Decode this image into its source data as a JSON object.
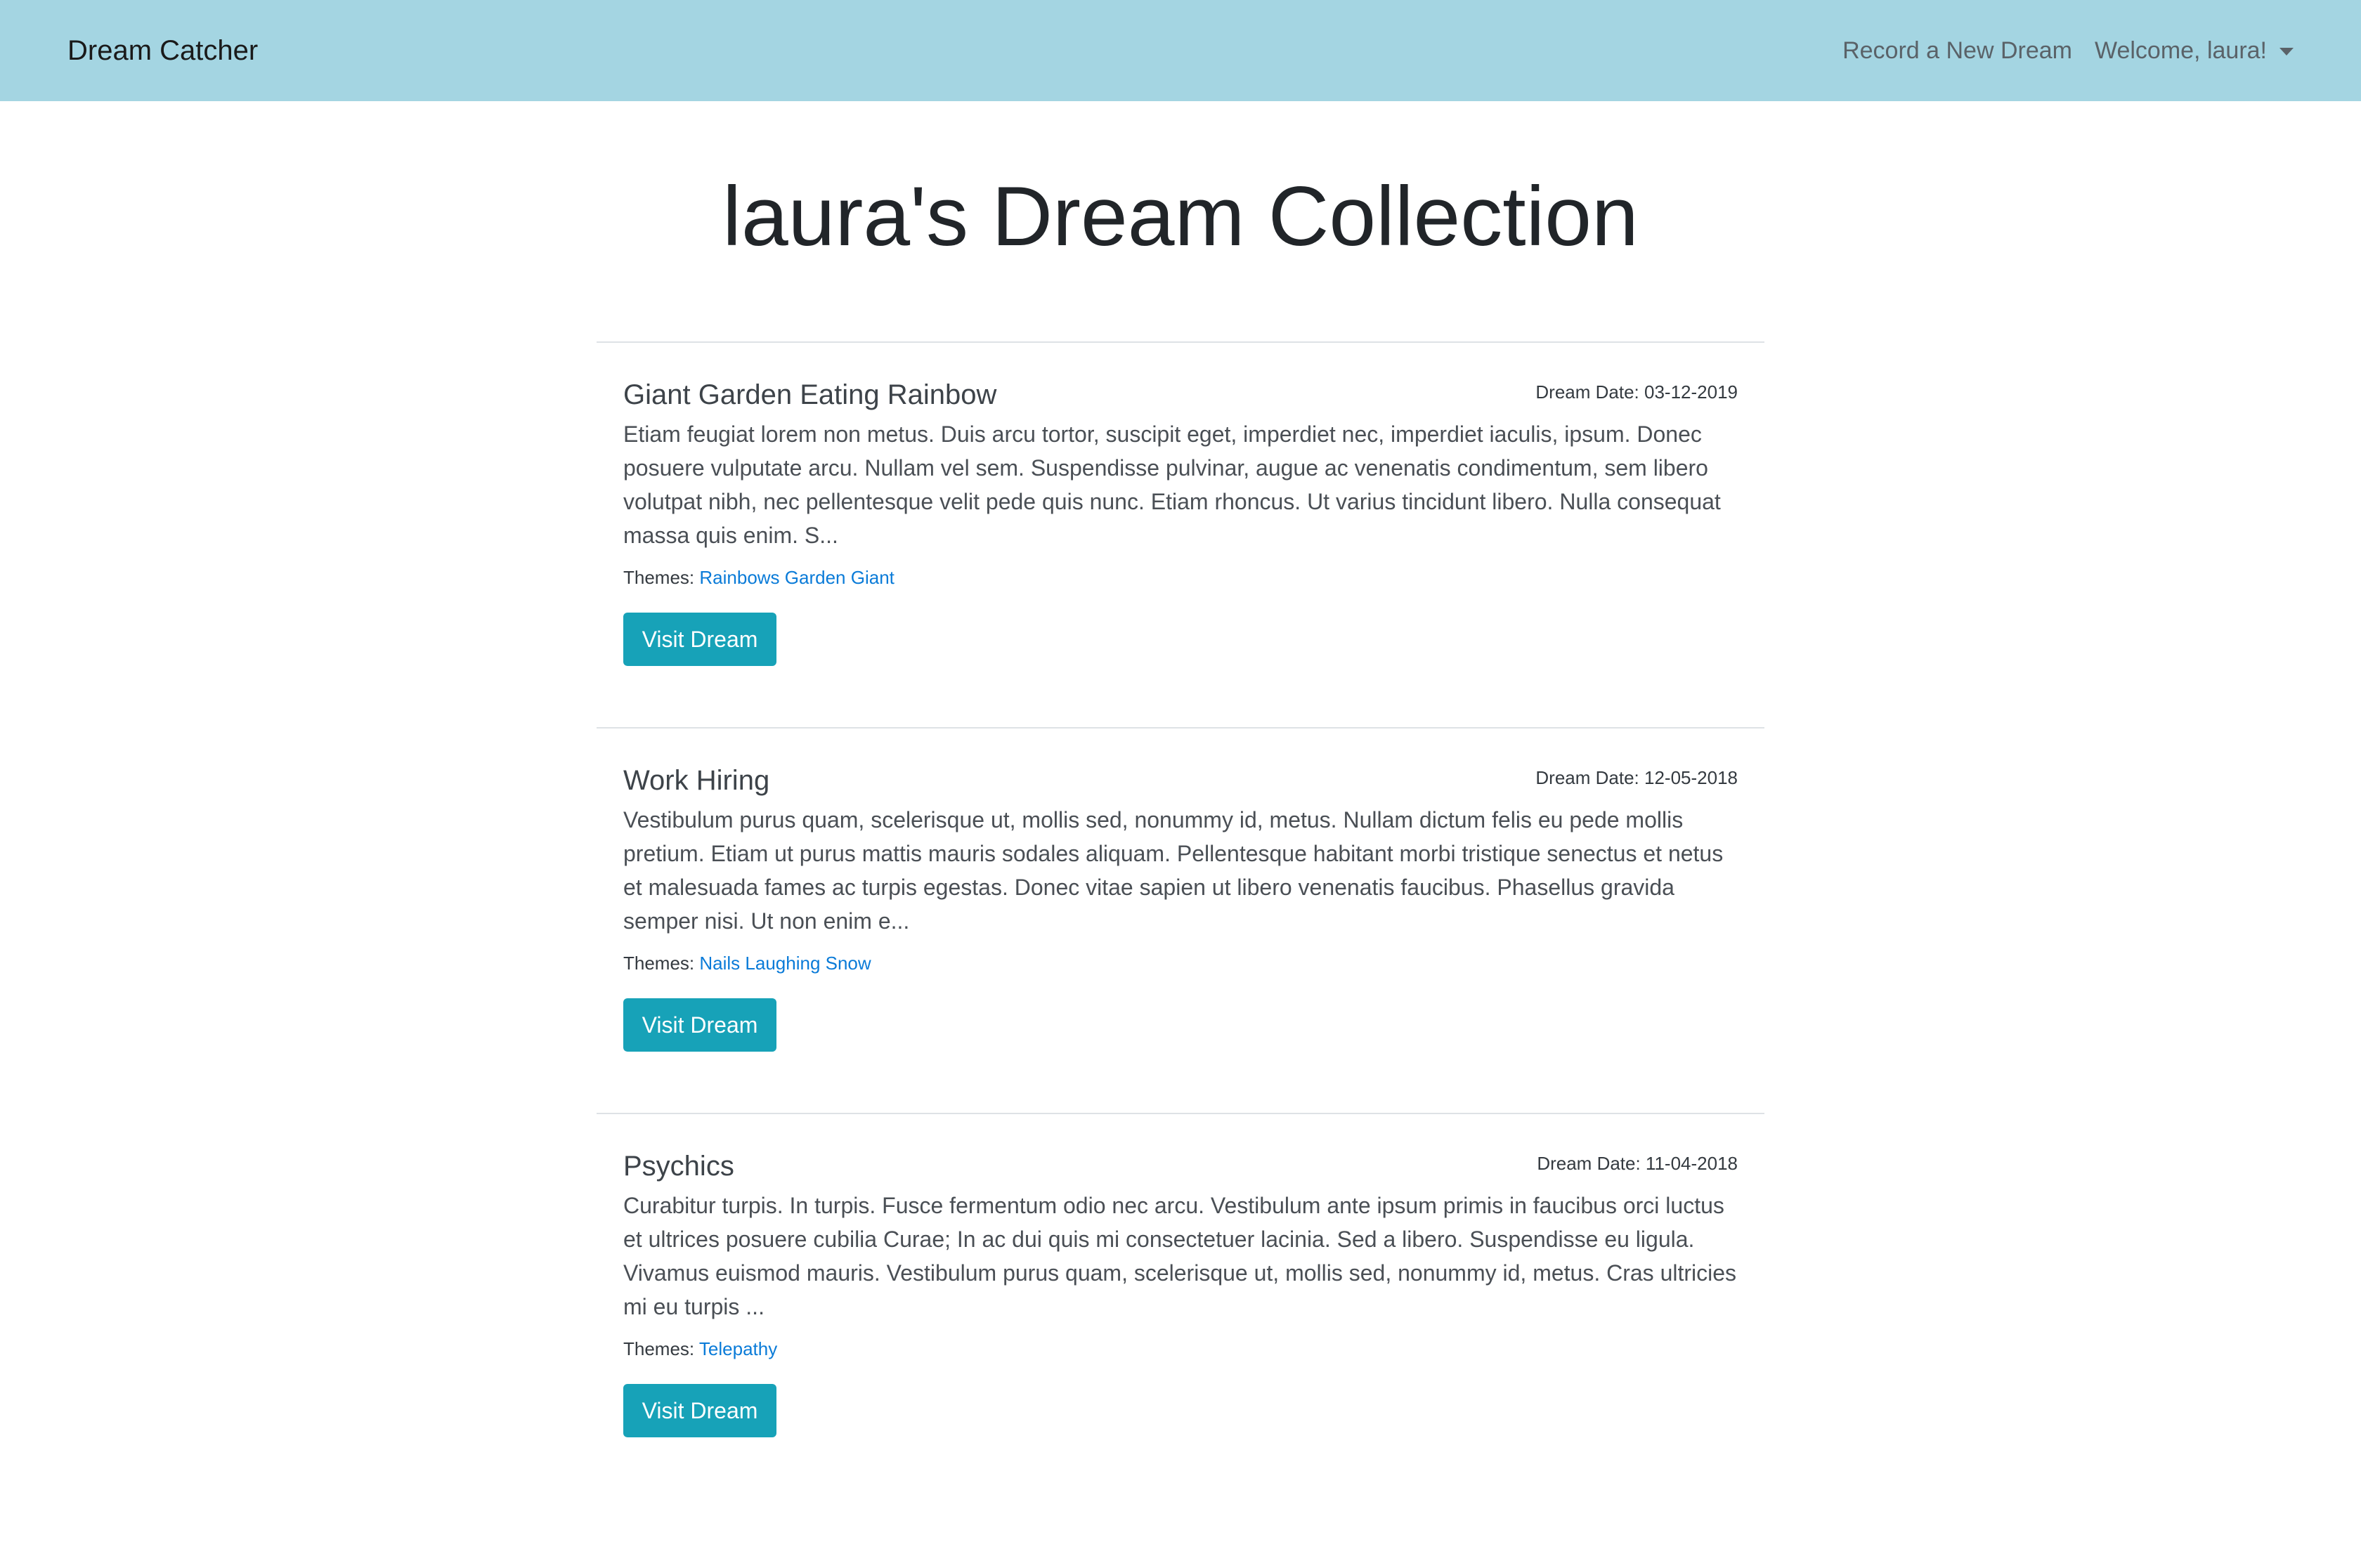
{
  "navbar": {
    "brand": "Dream Catcher",
    "record_link": "Record a New Dream",
    "welcome": "Welcome, laura!",
    "background_color": "#a4d5e2"
  },
  "page": {
    "title": "laura's Dream Collection"
  },
  "dreams": [
    {
      "title": "Giant Garden Eating Rainbow",
      "date": "Dream Date: 03-12-2019",
      "excerpt": "Etiam feugiat lorem non metus. Duis arcu tortor, suscipit eget, imperdiet nec, imperdiet iaculis, ipsum. Donec posuere vulputate arcu. Nullam vel sem. Suspendisse pulvinar, augue ac venenatis condimentum, sem libero volutpat nibh, nec pellentesque velit pede quis nunc. Etiam rhoncus. Ut varius tincidunt libero. Nulla consequat massa quis enim. S...",
      "themes_label": "Themes:",
      "themes": "Rainbows Garden Giant",
      "button": "Visit Dream"
    },
    {
      "title": "Work Hiring",
      "date": "Dream Date: 12-05-2018",
      "excerpt": "Vestibulum purus quam, scelerisque ut, mollis sed, nonummy id, metus. Nullam dictum felis eu pede mollis pretium. Etiam ut purus mattis mauris sodales aliquam. Pellentesque habitant morbi tristique senectus et netus et malesuada fames ac turpis egestas. Donec vitae sapien ut libero venenatis faucibus. Phasellus gravida semper nisi. Ut non enim e...",
      "themes_label": "Themes:",
      "themes": "Nails Laughing Snow",
      "button": "Visit Dream"
    },
    {
      "title": "Psychics",
      "date": "Dream Date: 11-04-2018",
      "excerpt": "Curabitur turpis. In turpis. Fusce fermentum odio nec arcu. Vestibulum ante ipsum primis in faucibus orci luctus et ultrices posuere cubilia Curae; In ac dui quis mi consectetuer lacinia. Sed a libero. Suspendisse eu ligula. Vivamus euismod mauris. Vestibulum purus quam, scelerisque ut, mollis sed, nonummy id, metus. Cras ultricies mi eu turpis ...",
      "themes_label": "Themes:",
      "themes": "Telepathy",
      "button": "Visit Dream"
    }
  ],
  "colors": {
    "button": "#17a2b8",
    "link": "#0a7bd8"
  }
}
